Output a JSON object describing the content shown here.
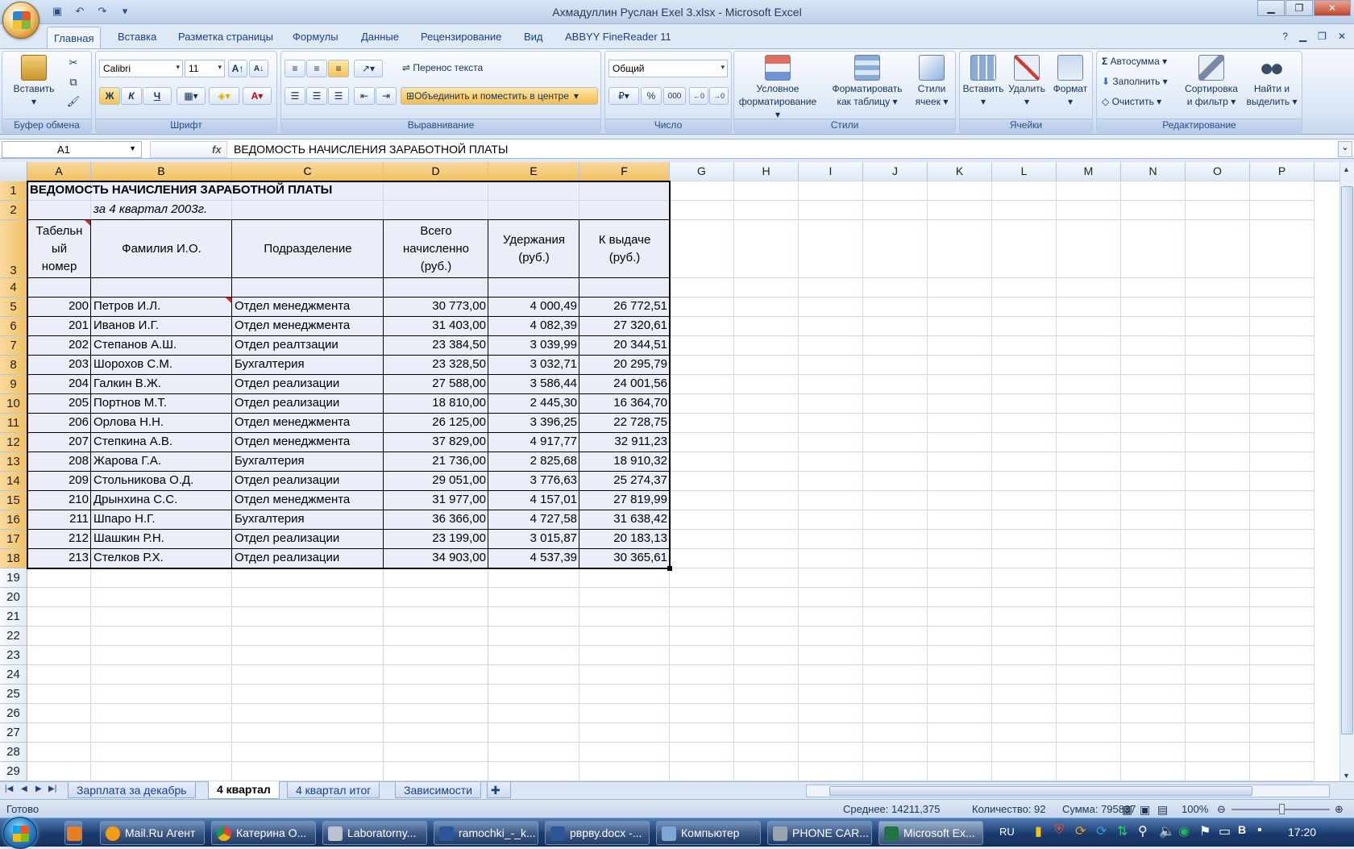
{
  "title": "Ахмадуллин Руслан Exel 3.xlsx - Microsoft Excel",
  "ribbon_tabs": [
    "Главная",
    "Вставка",
    "Разметка страницы",
    "Формулы",
    "Данные",
    "Рецензирование",
    "Вид",
    "ABBYY FineReader 11"
  ],
  "ribbon": {
    "clipboard": {
      "paste": "Вставить",
      "label": "Буфер обмена"
    },
    "font": {
      "name": "Calibri",
      "size": "11",
      "bold": "Ж",
      "italic": "К",
      "underline": "Ч",
      "label": "Шрифт"
    },
    "alignment": {
      "wrap": "Перенос текста",
      "merge": "Объединить и поместить в центре",
      "label": "Выравнивание"
    },
    "number": {
      "format": "Общий",
      "label": "Число",
      "percent": "%",
      "thousands": "000"
    },
    "styles": {
      "cond_line1": "Условное",
      "cond_line2": "форматирование",
      "table_line1": "Форматировать",
      "table_line2": "как таблицу",
      "cell_line1": "Стили",
      "cell_line2": "ячеек",
      "label": "Стили"
    },
    "cells": {
      "insert": "Вставить",
      "delete": "Удалить",
      "format": "Формат",
      "label": "Ячейки"
    },
    "editing": {
      "autosum": "Автосумма",
      "fill": "Заполнить",
      "clear": "Очистить",
      "sort_line1": "Сортировка",
      "sort_line2": "и фильтр",
      "find_line1": "Найти и",
      "find_line2": "выделить",
      "label": "Редактирование",
      "sigma": "Σ"
    }
  },
  "formula_bar": {
    "cell": "A1",
    "fx": "fx",
    "content": "ВЕДОМОСТЬ НАЧИСЛЕНИЯ ЗАРАБОТНОЙ ПЛАТЫ"
  },
  "columns": [
    "A",
    "B",
    "C",
    "D",
    "E",
    "F",
    "G",
    "H",
    "I",
    "J",
    "K",
    "L",
    "M",
    "N",
    "O",
    "P"
  ],
  "rows": [
    "1",
    "2",
    "3",
    "4",
    "5",
    "6",
    "7",
    "8",
    "9",
    "10",
    "11",
    "12",
    "13",
    "14",
    "15",
    "16",
    "17",
    "18",
    "19",
    "20",
    "21",
    "22",
    "23",
    "24",
    "25",
    "26",
    "27",
    "28",
    "29"
  ],
  "sheet": {
    "title": "ВЕДОМОСТЬ НАЧИСЛЕНИЯ ЗАРАБОТНОЙ ПЛАТЫ",
    "subtitle": "за 4 квартал 2003г.",
    "headers": {
      "a": [
        "Табельн",
        "ый",
        "номер"
      ],
      "b": "Фамилия И.О.",
      "c": "Подразделение",
      "d": [
        "Всего",
        "начисленно",
        "(руб.)"
      ],
      "e": [
        "Удержания",
        "(руб.)"
      ],
      "f": [
        "К выдаче",
        "(руб.)"
      ]
    },
    "data": [
      [
        "200",
        "Петров И.Л.",
        "Отдел менеджмента",
        "30 773,00",
        "4 000,49",
        "26 772,51"
      ],
      [
        "201",
        "Иванов И.Г.",
        "Отдел менеджмента",
        "31 403,00",
        "4 082,39",
        "27 320,61"
      ],
      [
        "202",
        "Степанов А.Ш.",
        "Отдел реалтзации",
        "23 384,50",
        "3 039,99",
        "20 344,51"
      ],
      [
        "203",
        "Шорохов С.М.",
        "Бухгалтерия",
        "23 328,50",
        "3 032,71",
        "20 295,79"
      ],
      [
        "204",
        "Галкин В.Ж.",
        "Отдел реализации",
        "27 588,00",
        "3 586,44",
        "24 001,56"
      ],
      [
        "205",
        "Портнов М.Т.",
        "Отдел реализации",
        "18 810,00",
        "2 445,30",
        "16 364,70"
      ],
      [
        "206",
        "Орлова Н.Н.",
        "Отдел менеджмента",
        "26 125,00",
        "3 396,25",
        "22 728,75"
      ],
      [
        "207",
        "Степкина А.В.",
        "Отдел менеджмента",
        "37 829,00",
        "4 917,77",
        "32 911,23"
      ],
      [
        "208",
        "Жарова Г.А.",
        "Бухгалтерия",
        "21 736,00",
        "2 825,68",
        "18 910,32"
      ],
      [
        "209",
        "Стольникова О.Д.",
        "Отдел реализации",
        "29 051,00",
        "3 776,63",
        "25 274,37"
      ],
      [
        "210",
        "Дрынхина С.С.",
        "Отдел менеджмента",
        "31 977,00",
        "4 157,01",
        "27 819,99"
      ],
      [
        "211",
        "Шпаро Н.Г.",
        "Бухгалтерия",
        "36 366,00",
        "4 727,58",
        "31 638,42"
      ],
      [
        "212",
        "Шашкин Р.Н.",
        "Отдел реализации",
        "23 199,00",
        "3 015,87",
        "20 183,13"
      ],
      [
        "213",
        "Стелков Р.Х.",
        "Отдел реализации",
        "34 903,00",
        "4 537,39",
        "30 365,61"
      ]
    ]
  },
  "sheet_tabs": [
    "Зарплата за декабрь",
    "4 квартал",
    "4 квартал итог",
    "Зависимости"
  ],
  "active_sheet": "4 квартал",
  "status": {
    "ready": "Готово",
    "average": "Среднее: 14211,375",
    "count": "Количество: 92",
    "sum": "Сумма: 795837",
    "zoom": "100%"
  },
  "taskbar": {
    "items": [
      "Mail.Ru Агент",
      "Катерина О...",
      "Laboratorny...",
      "ramochki_-_k...",
      "рврву.docx -...",
      "Компьютер",
      "PHONE CAR...",
      "Microsoft Ex..."
    ],
    "lang": "RU",
    "clock": "17:20"
  }
}
